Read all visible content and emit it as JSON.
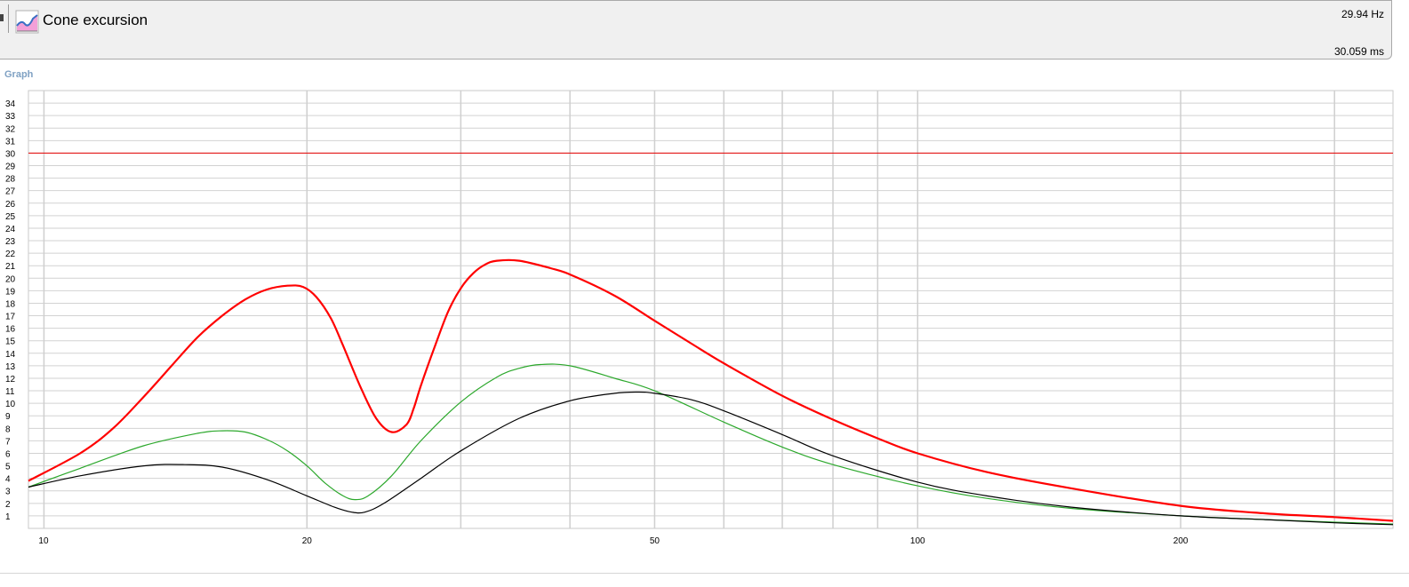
{
  "header": {
    "title": "Cone excursion",
    "frequency_readout": "29.94 Hz",
    "time_readout": "30.059 ms",
    "icon": "graph-icon"
  },
  "section": {
    "label": "Graph"
  },
  "chart_data": {
    "type": "line",
    "title": "",
    "xlabel": "",
    "ylabel": "",
    "x_scale": "log",
    "xlim": [
      9.6,
      350
    ],
    "ylim": [
      0,
      35
    ],
    "x_ticks": [
      10,
      20,
      50,
      100,
      200
    ],
    "y_ticks": [
      1,
      2,
      3,
      4,
      5,
      6,
      7,
      8,
      9,
      10,
      11,
      12,
      13,
      14,
      15,
      16,
      17,
      18,
      19,
      20,
      21,
      22,
      23,
      24,
      25,
      26,
      27,
      28,
      29,
      30,
      31,
      32,
      33,
      34
    ],
    "grid": true,
    "limit_line": {
      "y": 30,
      "color": "#e60000"
    },
    "series": [
      {
        "color": "#ff0000",
        "x": [
          9.6,
          11,
          12,
          13,
          14,
          15,
          16,
          17,
          18,
          19,
          19.8,
          20.5,
          21.3,
          22,
          23,
          24,
          25,
          26,
          26.5,
          27,
          28,
          29,
          30,
          31,
          32,
          33,
          35,
          38,
          40,
          45,
          50,
          55,
          60,
          70,
          80,
          90,
          100,
          120,
          150,
          200,
          250,
          300,
          350
        ],
        "values": [
          3.8,
          6.0,
          8.0,
          10.5,
          13.0,
          15.3,
          17.0,
          18.3,
          19.1,
          19.4,
          19.3,
          18.5,
          16.8,
          14.6,
          11.4,
          8.8,
          7.7,
          8.3,
          9.6,
          11.4,
          14.5,
          17.3,
          19.2,
          20.4,
          21.1,
          21.4,
          21.4,
          20.8,
          20.3,
          18.6,
          16.6,
          14.8,
          13.2,
          10.6,
          8.7,
          7.2,
          6.0,
          4.5,
          3.2,
          1.8,
          1.2,
          0.9,
          0.6
        ]
      },
      {
        "color": "#2ca82c",
        "x": [
          9.6,
          11,
          13,
          15,
          16,
          17,
          18,
          19,
          20,
          21,
          22,
          22.7,
          23.5,
          25,
          27,
          30,
          33,
          35,
          37,
          40,
          45,
          50,
          60,
          70,
          80,
          100,
          120,
          150,
          200,
          250,
          300,
          350
        ],
        "values": [
          3.3,
          4.8,
          6.6,
          7.6,
          7.8,
          7.7,
          7.1,
          6.2,
          5.0,
          3.6,
          2.6,
          2.3,
          2.6,
          4.2,
          7.0,
          10.1,
          12.1,
          12.8,
          13.1,
          13.0,
          12.0,
          11.0,
          8.5,
          6.5,
          5.1,
          3.4,
          2.4,
          1.6,
          1.0,
          0.7,
          0.5,
          0.35
        ]
      },
      {
        "color": "#000000",
        "x": [
          9.6,
          11,
          13,
          14.5,
          16,
          18,
          20,
          21.5,
          22.5,
          23.3,
          24.5,
          27,
          30,
          35,
          40,
          45,
          48,
          50,
          55,
          60,
          70,
          80,
          100,
          120,
          150,
          200,
          250,
          300,
          350
        ],
        "values": [
          3.3,
          4.2,
          5.0,
          5.1,
          4.9,
          3.9,
          2.6,
          1.7,
          1.3,
          1.3,
          2.0,
          4.0,
          6.2,
          8.8,
          10.2,
          10.8,
          10.9,
          10.8,
          10.3,
          9.4,
          7.5,
          5.8,
          3.7,
          2.6,
          1.7,
          1.0,
          0.7,
          0.45,
          0.3
        ]
      }
    ]
  }
}
